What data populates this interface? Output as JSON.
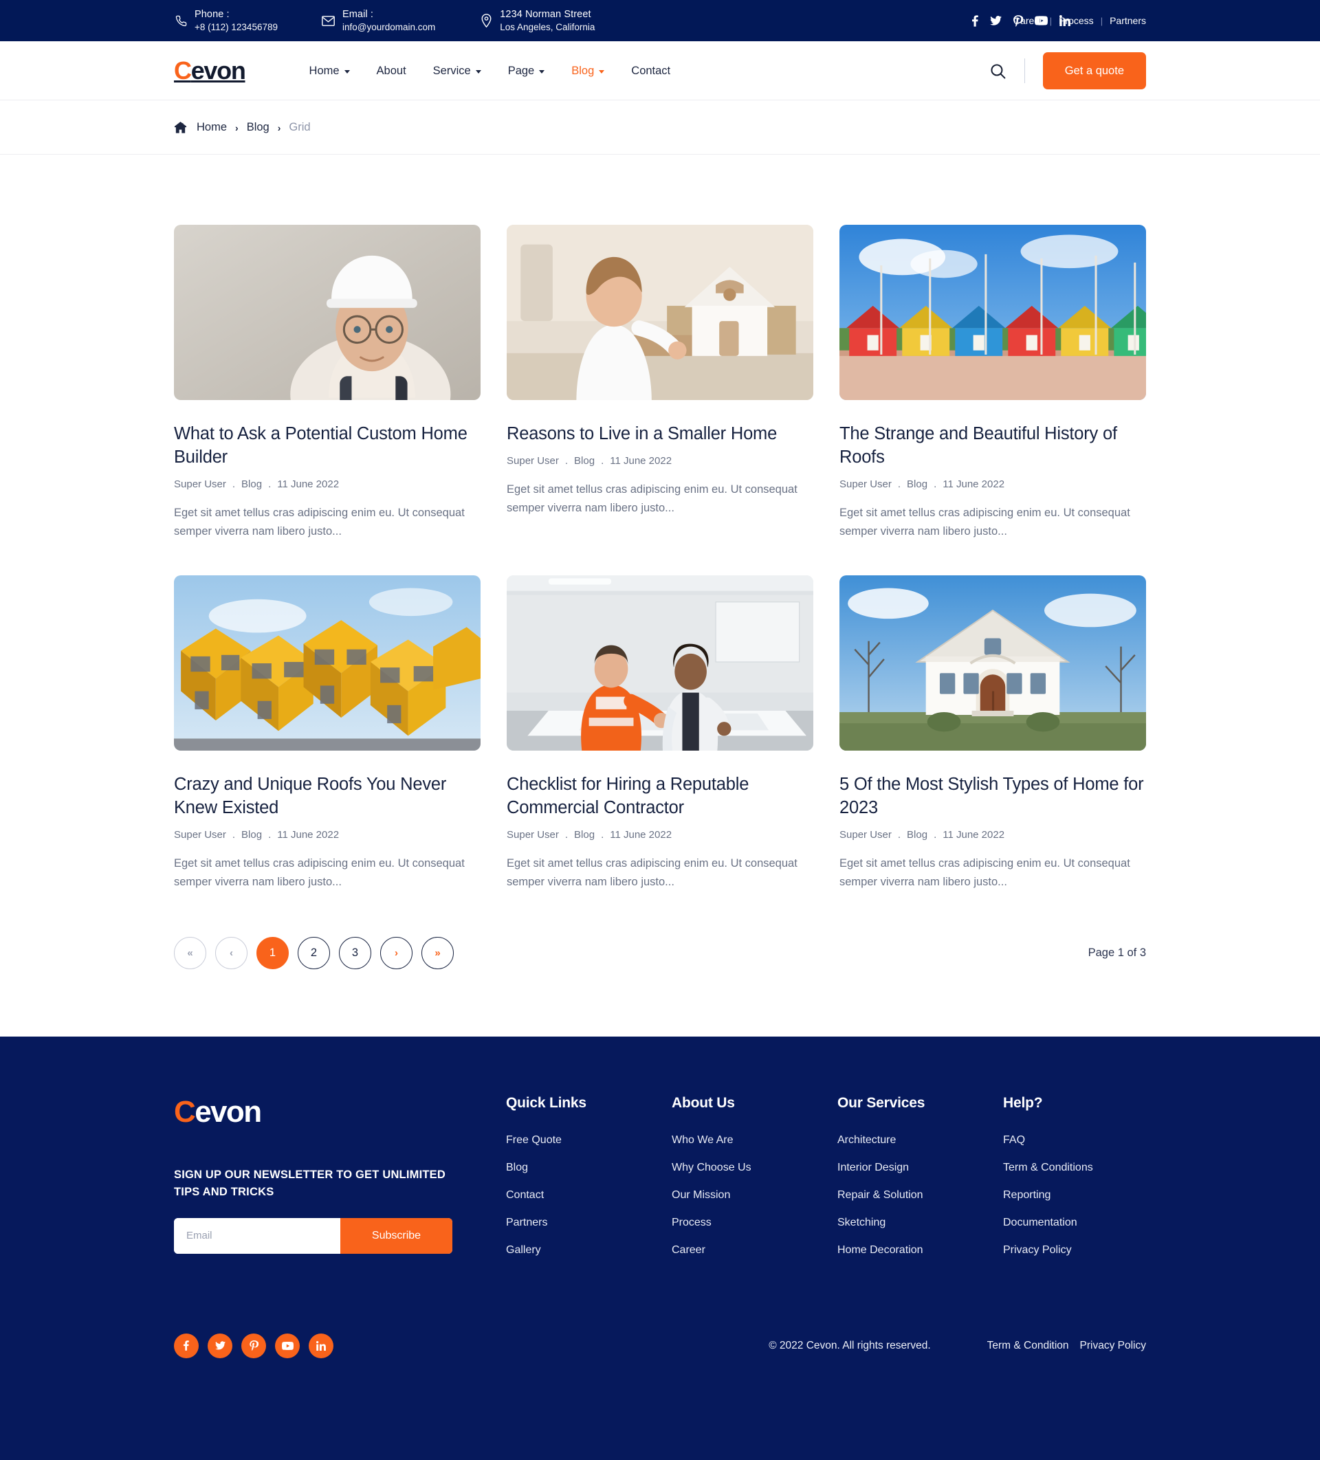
{
  "theme": {
    "navy": "#021857",
    "footer_navy": "#06195c",
    "orange": "#F9631B",
    "heading": "#16213f",
    "muted": "#6a7285"
  },
  "topbar": {
    "phone": {
      "icon": "phone-icon",
      "label": "Phone :",
      "value": "+8 (112) 123456789"
    },
    "email": {
      "icon": "envelope-icon",
      "label": "Email :",
      "value": "info@yourdomain.com"
    },
    "address": {
      "icon": "map-pin-icon",
      "label": "1234 Norman Street",
      "value": "Los Angeles, California"
    },
    "social": [
      {
        "name": "facebook-icon",
        "label": "f"
      },
      {
        "name": "twitter-icon",
        "label": "t"
      },
      {
        "name": "pinterest-icon",
        "label": "p"
      },
      {
        "name": "youtube-icon",
        "label": "y"
      },
      {
        "name": "linkedin-icon",
        "label": "in"
      }
    ],
    "links": [
      "Career",
      "Process",
      "Partners"
    ],
    "separator": "|"
  },
  "navbar": {
    "logo": {
      "first": "C",
      "rest": "evon"
    },
    "menu": [
      {
        "label": "Home",
        "has_caret": true,
        "active": false
      },
      {
        "label": "About",
        "has_caret": false,
        "active": false
      },
      {
        "label": "Service",
        "has_caret": true,
        "active": false
      },
      {
        "label": "Page",
        "has_caret": true,
        "active": false
      },
      {
        "label": "Blog",
        "has_caret": true,
        "active": true
      },
      {
        "label": "Contact",
        "has_caret": false,
        "active": false
      }
    ],
    "search_icon": "search-icon",
    "quote_label": "Get a quote"
  },
  "breadcrumb": {
    "home_icon": "home-icon",
    "items": [
      "Home",
      "Blog",
      "Grid"
    ],
    "separator": "›",
    "current": "Grid"
  },
  "blog": {
    "posts": [
      {
        "title": "What to Ask a Potential Custom Home Builder",
        "author": "Super User",
        "category": "Blog",
        "date": "11 June 2022",
        "excerpt": "Eget sit amet tellus cras adipiscing enim eu. Ut consequat semper viverra nam libero justo...",
        "image_alt": "portrait of builder wearing white hard hat and glasses"
      },
      {
        "title": "Reasons to Live in a Smaller Home",
        "author": "Super User",
        "category": "Blog",
        "date": "11 June 2022",
        "excerpt": "Eget sit amet tellus cras adipiscing enim eu. Ut consequat semper viverra nam libero justo...",
        "image_alt": "toddler playing with a wooden dollhouse"
      },
      {
        "title": "The Strange and Beautiful History of Roofs",
        "author": "Super User",
        "category": "Blog",
        "date": "11 June 2022",
        "excerpt": "Eget sit amet tellus cras adipiscing enim eu. Ut consequat semper viverra nam libero justo...",
        "image_alt": "row of brightly coloured beach huts under blue sky"
      },
      {
        "title": "Crazy and Unique Roofs You Never Knew Existed",
        "author": "Super User",
        "category": "Blog",
        "date": "11 June 2022",
        "excerpt": "Eget sit amet tellus cras adipiscing enim eu. Ut consequat semper viverra nam libero justo...",
        "image_alt": "yellow tilted cube houses against sky"
      },
      {
        "title": "Checklist for Hiring a Reputable Commercial Contractor",
        "author": "Super User",
        "category": "Blog",
        "date": "11 June 2022",
        "excerpt": "Eget sit amet tellus cras adipiscing enim eu. Ut consequat semper viverra nam libero justo...",
        "image_alt": "two workers reviewing blueprints on a table"
      },
      {
        "title": "5 Of the Most Stylish Types of Home for 2023",
        "author": "Super User",
        "category": "Blog",
        "date": "11 June 2022",
        "excerpt": "Eget sit amet tellus cras adipiscing enim eu. Ut consequat semper viverra nam libero justo...",
        "image_alt": "white gabled manor house with bare trees"
      }
    ],
    "meta_dot": ".",
    "pagination": {
      "first_label": "«",
      "prev_label": "‹",
      "pages": [
        "1",
        "2",
        "3"
      ],
      "active_page": "1",
      "next_label": "›",
      "last_label": "»",
      "status": "Page 1 of 3"
    }
  },
  "footer": {
    "logo": {
      "first": "C",
      "rest": "evon"
    },
    "newsletter": {
      "headline": "SIGN UP OUR NEWSLETTER TO GET UNLIMITED TIPS AND TRICKS",
      "placeholder": "Email",
      "value": "",
      "button": "Subscribe"
    },
    "columns": [
      {
        "title": "Quick Links",
        "links": [
          "Free Quote",
          "Blog",
          "Contact",
          "Partners",
          "Gallery"
        ]
      },
      {
        "title": "About Us",
        "links": [
          "Who We Are",
          "Why Choose Us",
          "Our Mission",
          "Process",
          "Career"
        ]
      },
      {
        "title": "Our Services",
        "links": [
          "Architecture",
          "Interior Design",
          "Repair & Solution",
          "Sketching",
          "Home Decoration"
        ]
      },
      {
        "title": "Help?",
        "links": [
          "FAQ",
          "Term & Conditions",
          "Reporting",
          "Documentation",
          "Privacy Policy"
        ]
      }
    ],
    "social": [
      {
        "name": "facebook-icon"
      },
      {
        "name": "twitter-icon"
      },
      {
        "name": "pinterest-icon"
      },
      {
        "name": "youtube-icon"
      },
      {
        "name": "linkedin-icon"
      }
    ],
    "copyright": "© 2022 Cevon. All rights reserved.",
    "legal": [
      "Term & Condition",
      "Privacy Policy"
    ]
  }
}
